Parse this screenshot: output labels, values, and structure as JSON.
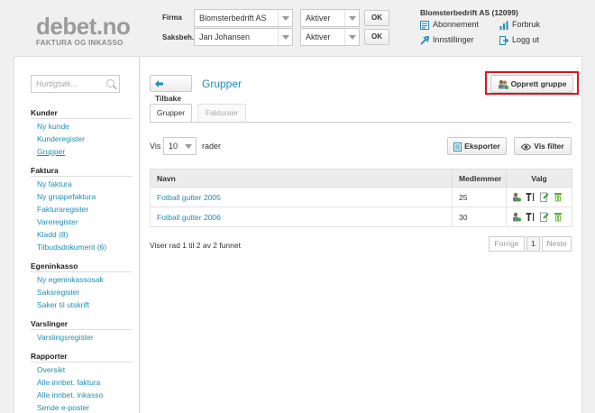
{
  "brand": {
    "name": "debet.no",
    "tagline": "FAKTURA OG INKASSO"
  },
  "header": {
    "firma_label": "Firma",
    "firma_value": "Blomsterbedrift AS",
    "firma_action": "Aktiver",
    "saksbeh_label": "Saksbeh.",
    "saksbeh_value": "Jan Johansen",
    "saksbeh_action": "Aktiver",
    "ok_label": "OK",
    "account_title": "Blomsterbedrift AS (12099)",
    "links": {
      "abonnement": "Abonnement",
      "innstillinger": "Innstillinger",
      "forbruk": "Forbruk",
      "logg_ut": "Logg ut"
    }
  },
  "sidebar": {
    "search_placeholder": "Hurtigsøk...",
    "sections": [
      {
        "title": "Kunder",
        "items": [
          "Ny kunde",
          "Kunderegister",
          "Grupper"
        ]
      },
      {
        "title": "Faktura",
        "items": [
          "Ny faktura",
          "Ny gruppefaktura",
          "Fakturaregister",
          "Vareregister",
          "Kladd (8)",
          "Tilbudsdokument (6)"
        ]
      },
      {
        "title": "Egeninkasso",
        "items": [
          "Ny egeninkassosak",
          "Saksregister",
          "Saker til utskrift"
        ]
      },
      {
        "title": "Varslinger",
        "items": [
          "Varslingsregister"
        ]
      },
      {
        "title": "Rapporter",
        "items": [
          "Oversikt",
          "Alle innbet. faktura",
          "Alle innbet. inkasso",
          "Sende e-poster"
        ]
      }
    ]
  },
  "main": {
    "back_label": "Tilbake",
    "title": "Grupper",
    "create_label": "Opprett gruppe",
    "tabs": [
      "Grupper",
      "Fakturaer"
    ],
    "show_label": "Vis",
    "rows_value": "10",
    "rows_label": "rader",
    "export_label": "Eksporter",
    "filter_label": "Vis filter",
    "columns": [
      "Navn",
      "Medlemmer",
      "Valg"
    ],
    "rows": [
      {
        "name": "Fotball gutter 2005",
        "members": "25"
      },
      {
        "name": "Fotball gutter 2006",
        "members": "30"
      }
    ],
    "summary": "Viser rad 1 til 2 av 2 funnet",
    "pagination": {
      "prev": "Forrige",
      "page": "1",
      "next": "Neste"
    }
  },
  "colors": {
    "accent": "#1f8db3",
    "highlight": "#e0121b"
  }
}
